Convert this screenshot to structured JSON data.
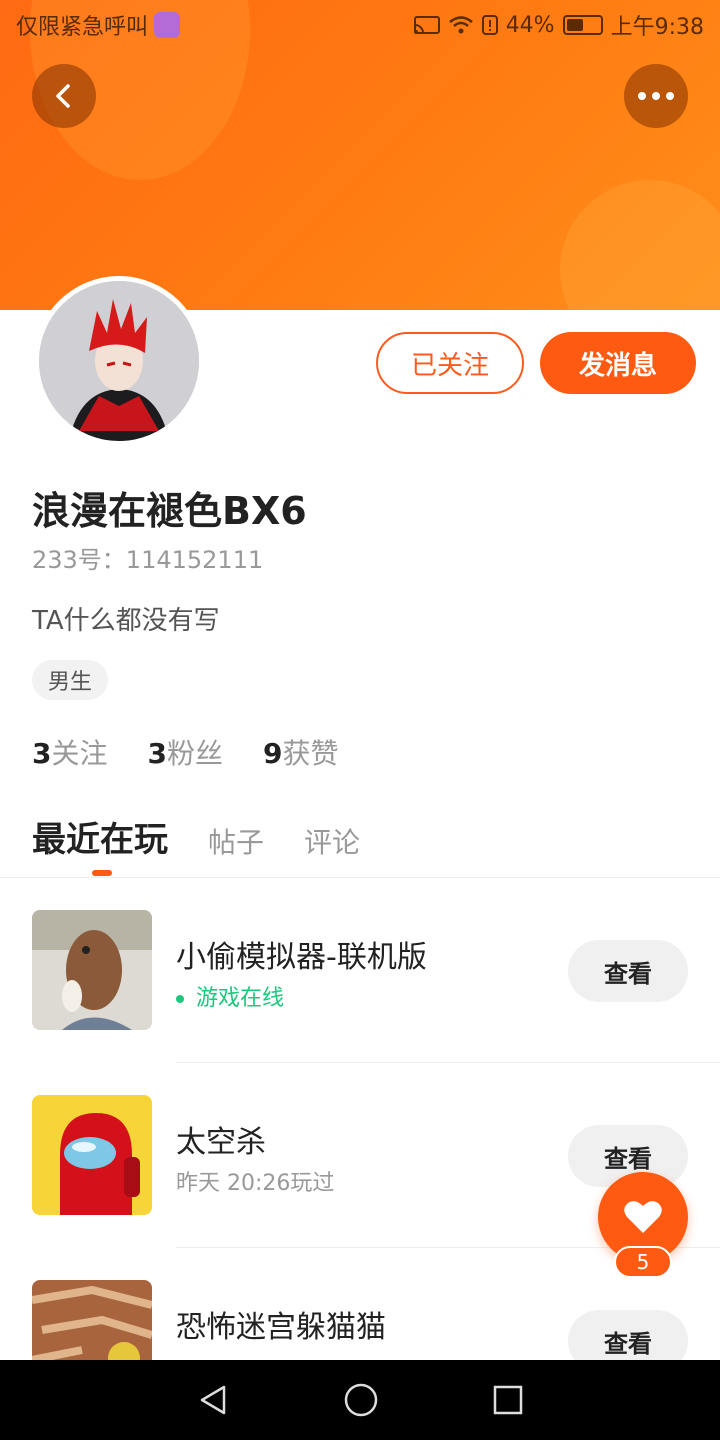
{
  "status_bar": {
    "carrier_text": "仅限紧急呼叫",
    "battery": "44%",
    "time": "上午9:38",
    "battery_level": 0.44
  },
  "header": {
    "back_icon": "chevron-left-icon",
    "more_icon": "more-horizontal-icon",
    "accent": "#ff6a13"
  },
  "profile": {
    "name": "浪漫在褪色BX6",
    "id_text": "233号：114152111",
    "bio": "TA什么都没有写",
    "gender": "男生",
    "follow_label": "已关注",
    "message_label": "发消息"
  },
  "stats": [
    {
      "num": "3",
      "label": "关注"
    },
    {
      "num": "3",
      "label": "粉丝"
    },
    {
      "num": "9",
      "label": "获赞"
    }
  ],
  "tabs": [
    "最近在玩",
    "帖子",
    "评论"
  ],
  "games": [
    {
      "title": "小偷模拟器-联机版",
      "sub": "游戏在线",
      "online": true,
      "button": "查看"
    },
    {
      "title": "太空杀",
      "sub": "昨天 20:26玩过",
      "online": false,
      "button": "查看"
    },
    {
      "title": "恐怖迷宫躲猫猫",
      "sub": "",
      "online": false,
      "button": "查看"
    }
  ],
  "like": {
    "count": "5",
    "icon": "heart-icon"
  }
}
